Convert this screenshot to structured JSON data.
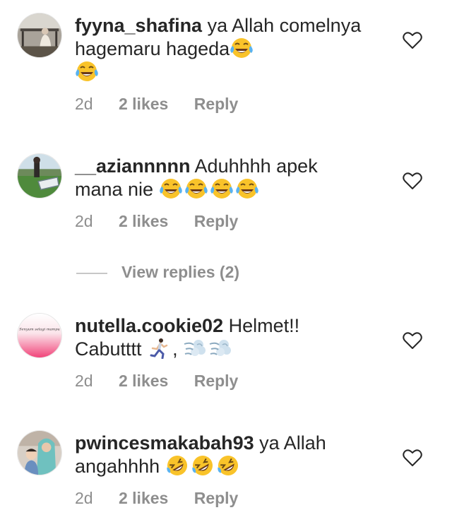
{
  "comments": [
    {
      "username": "fyyna_shafina",
      "text": "ya Allah comelnya hagemaru hageda",
      "emojis": [
        "face-with-tears-of-joy",
        "face-with-tears-of-joy"
      ],
      "time": "2d",
      "likes": "2 likes",
      "reply": "Reply"
    },
    {
      "username": "__aziannnnn",
      "text": "Aduhhhh apek mana nie",
      "emojis": [
        "face-with-tears-of-joy",
        "face-with-tears-of-joy",
        "face-with-tears-of-joy",
        "face-with-tears-of-joy"
      ],
      "time": "2d",
      "likes": "2 likes",
      "reply": "Reply"
    },
    {
      "username": "nutella.cookie02",
      "text": "Helmet!! Cabutttt",
      "text_tail": ",",
      "emojis": [
        "person-running",
        "dashing-away",
        "dashing-away"
      ],
      "avatar_text": "Senyum selagi mampu",
      "time": "2d",
      "likes": "2 likes",
      "reply": "Reply"
    },
    {
      "username": "pwincesmakabah93",
      "text": "ya Allah angahhhh",
      "emojis": [
        "rolling-on-floor-laughing",
        "rolling-on-floor-laughing",
        "rolling-on-floor-laughing"
      ],
      "time": "2d",
      "likes": "2 likes",
      "reply": "Reply"
    }
  ],
  "view_replies": "View replies (2)",
  "colors": {
    "text": "#262626",
    "muted": "#8e8e8e",
    "divider": "#c7c7c7",
    "background": "#ffffff"
  }
}
